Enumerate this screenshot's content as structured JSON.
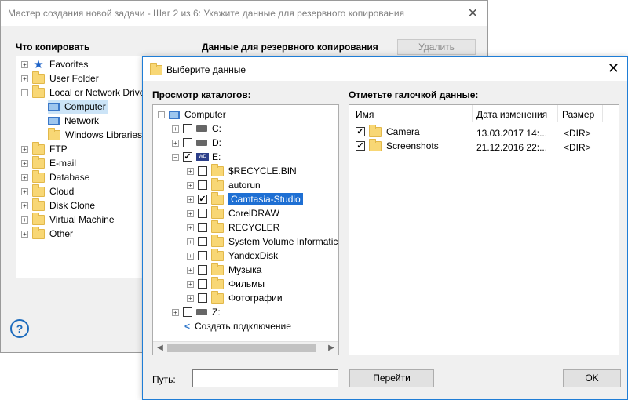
{
  "wizard": {
    "title": "Мастер создания новой задачи - Шаг 2 из 6: Укажите данные для резервного копирования",
    "what_to_copy": "Что копировать",
    "backup_data": "Данные для резервного копирования",
    "delete_button": "Удалить",
    "tree": [
      {
        "label": "Favorites",
        "icon": "star-icon"
      },
      {
        "label": "User Folder",
        "icon": "folder-icon"
      },
      {
        "label": "Local or Network Drive",
        "icon": "folder-icon"
      },
      {
        "label": "Computer",
        "icon": "monitor-icon"
      },
      {
        "label": "Network",
        "icon": "monitor-icon"
      },
      {
        "label": "Windows Libraries",
        "icon": "folder-icon"
      },
      {
        "label": "FTP",
        "icon": "folder-icon"
      },
      {
        "label": "E-mail",
        "icon": "folder-icon"
      },
      {
        "label": "Database",
        "icon": "folder-icon"
      },
      {
        "label": "Cloud",
        "icon": "folder-icon"
      },
      {
        "label": "Disk Clone",
        "icon": "folder-icon"
      },
      {
        "label": "Virtual Machine",
        "icon": "folder-icon"
      },
      {
        "label": "Other",
        "icon": "folder-icon"
      }
    ],
    "help": "?"
  },
  "dialog": {
    "title": "Выберите данные",
    "browse_label": "Просмотр каталогов:",
    "check_label": "Отметьте галочкой данные:",
    "dir_tree": {
      "root": "Computer",
      "drives": [
        "C:",
        "D:",
        "E:",
        "Z:"
      ],
      "e_folders": [
        "$RECYCLE.BIN",
        "autorun",
        "Camtasia-Studio",
        "CorelDRAW",
        "RECYCLER",
        "System Volume Informatic",
        "YandexDisk",
        "Музыка",
        "Фильмы",
        "Фотографии"
      ],
      "create_connection": "Создать подключение"
    },
    "columns": {
      "name": "Имя",
      "modified": "Дата изменения",
      "size": "Размер"
    },
    "files": [
      {
        "name": "Camera",
        "modified": "13.03.2017 14:...",
        "size": "<DIR>",
        "checked": true
      },
      {
        "name": "Screenshots",
        "modified": "21.12.2016 22:...",
        "size": "<DIR>",
        "checked": true
      }
    ],
    "path_label": "Путь:",
    "path_value": "",
    "go_button": "Перейти",
    "ok_button": "OK"
  },
  "colors": {
    "selection": "#1e6fd3",
    "dialog_border": "#1f7dd6"
  }
}
